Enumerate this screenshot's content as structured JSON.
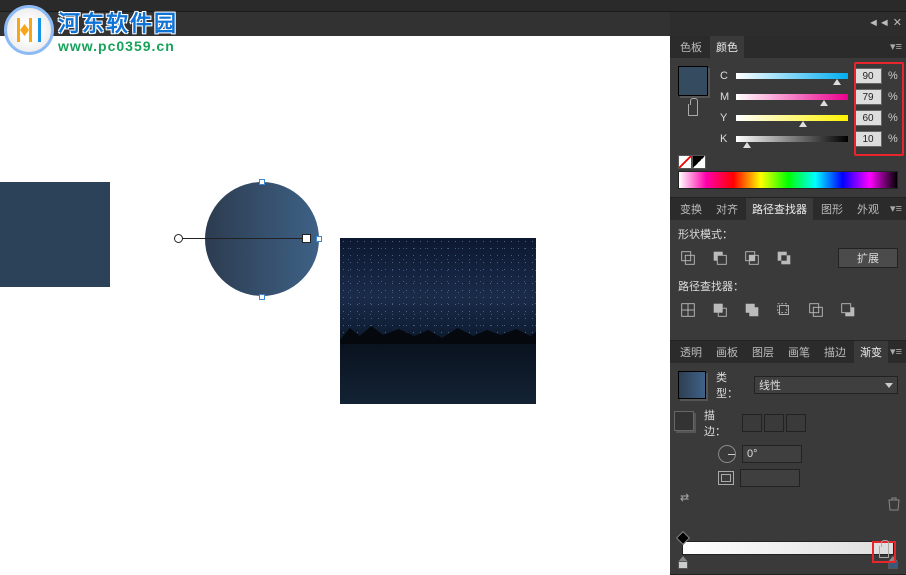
{
  "watermark": {
    "title": "河东软件园",
    "url": "www.pc0359.cn"
  },
  "topbar": {},
  "panels": {
    "color": {
      "tabs": [
        "色板",
        "颜色"
      ],
      "active_tab": "颜色",
      "sliders": [
        {
          "label": "C",
          "value": "90",
          "percent": 90
        },
        {
          "label": "M",
          "value": "79",
          "percent": 79
        },
        {
          "label": "Y",
          "value": "60",
          "percent": 60
        },
        {
          "label": "K",
          "value": "10",
          "percent": 10
        }
      ],
      "pct_sign": "%"
    },
    "pathfinder": {
      "tabs": [
        "变换",
        "对齐",
        "路径查找器",
        "图形",
        "外观"
      ],
      "active_tab": "路径查找器",
      "shape_mode_label": "形状模式：",
      "pathfinder_label": "路径查找器：",
      "expand_label": "扩展"
    },
    "gradient": {
      "tabs": [
        "透明",
        "画板",
        "图层",
        "画笔",
        "描边",
        "渐变"
      ],
      "active_tab": "渐变",
      "type_label": "类型：",
      "type_value": "线性",
      "stroke_label": "描边：",
      "angle_value": "0°",
      "aspect_value": ""
    }
  },
  "chart_data": null
}
